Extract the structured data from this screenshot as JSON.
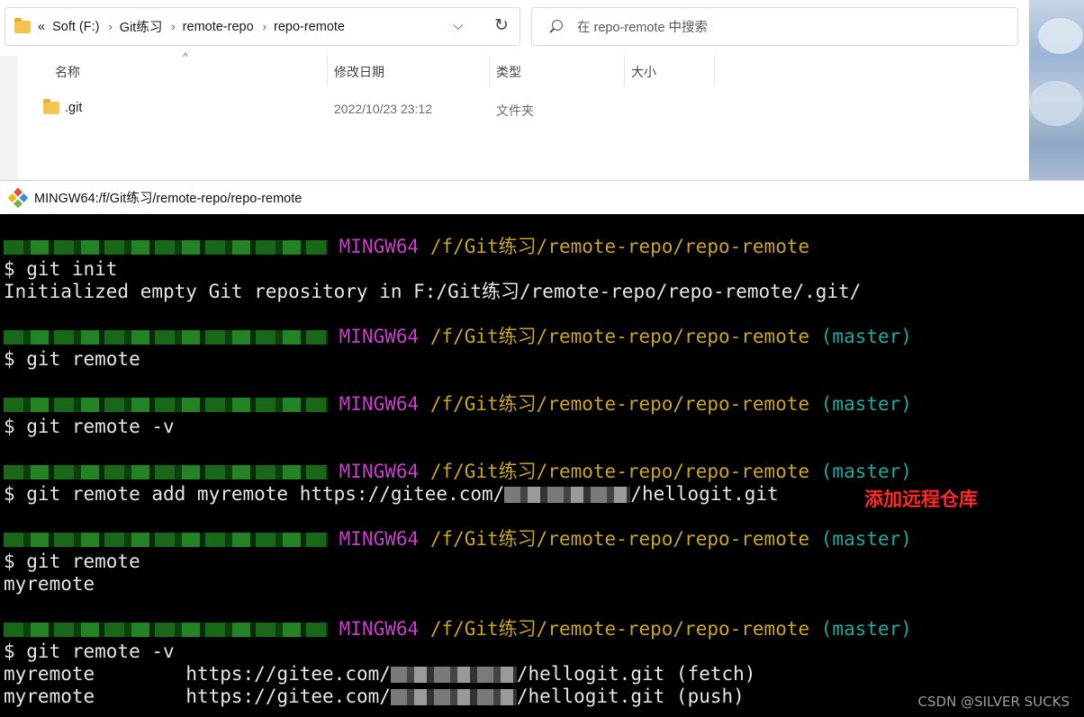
{
  "explorer": {
    "breadcrumb": {
      "overflow": "«",
      "items": [
        "Soft (F:)",
        "Git练习",
        "remote-repo",
        "repo-remote"
      ]
    },
    "search_placeholder": "在 repo-remote 中搜索",
    "columns": [
      "名称",
      "修改日期",
      "类型",
      "大小"
    ],
    "files": [
      {
        "name": ".git",
        "modified": "2022/10/23 23:12",
        "type": "文件夹",
        "size": ""
      }
    ]
  },
  "terminal": {
    "title": "MINGW64:/f/Git练习/remote-repo/repo-remote",
    "prompt_env": "MINGW64",
    "prompt_path": "/f/Git练习/remote-repo/repo-remote",
    "branch": "(master)",
    "blocks": [
      {
        "command": "$ git init",
        "output": [
          "Initialized empty Git repository in F:/Git练习/remote-repo/repo-remote/.git/"
        ],
        "show_branch": false
      },
      {
        "command": "$ git remote",
        "output": [],
        "show_branch": true
      },
      {
        "command": "$ git remote -v",
        "output": [],
        "show_branch": true
      },
      {
        "command_prefix": "$ git remote add myremote https://gitee.com/",
        "command_suffix": "/hellogit.git",
        "output": [],
        "show_branch": true
      },
      {
        "command": "$ git remote",
        "output": [
          "myremote"
        ],
        "show_branch": true
      },
      {
        "command": "$ git remote -v",
        "output": [],
        "show_branch": true
      }
    ],
    "remote_v_lines": [
      {
        "name": "myremote",
        "url_prefix": "https://gitee.com/",
        "url_suffix": "/hellogit.git",
        "kind": "(fetch)"
      },
      {
        "name": "myremote",
        "url_prefix": "https://gitee.com/",
        "url_suffix": "/hellogit.git",
        "kind": "(push)"
      }
    ],
    "annotation": "添加远程仓库"
  },
  "watermark": "CSDN @SILVER SUCKS",
  "colors": {
    "prompt_env": "#c83fc9",
    "prompt_path": "#c9a526",
    "branch": "#1fa9a0",
    "annotation": "#ff2a2a"
  }
}
